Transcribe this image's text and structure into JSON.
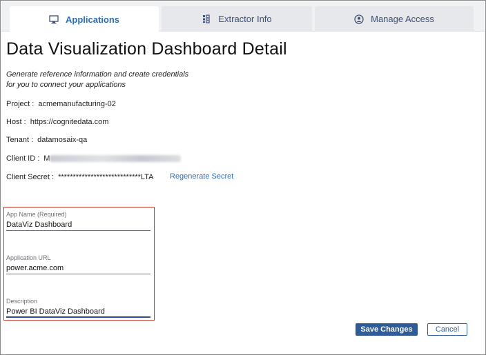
{
  "tabs": [
    {
      "label": "Applications",
      "icon": "monitor-icon",
      "active": true
    },
    {
      "label": "Extractor Info",
      "icon": "extractor-icon",
      "active": false
    },
    {
      "label": "Manage Access",
      "icon": "user-circle-icon",
      "active": false
    }
  ],
  "page": {
    "title": "Data Visualization Dashboard Detail",
    "subtitle_line1": "Generate reference information and create credentials",
    "subtitle_line2": "for you to connect your applications"
  },
  "info": {
    "project_label": "Project :",
    "project_value": "acmemanufacturing-02",
    "host_label": "Host :",
    "host_value": "https://cognitedata.com",
    "tenant_label": "Tenant :",
    "tenant_value": "datamosaix-qa",
    "client_id_label": "Client ID :",
    "client_id_prefix": "M",
    "client_secret_label": "Client Secret :",
    "client_secret_value": "****************************LTA",
    "regenerate_label": "Regenerate Secret"
  },
  "form": {
    "app_name_label": "App Name (Required)",
    "app_name_value": "DataViz Dashboard",
    "app_url_label": "Application URL",
    "app_url_value": "power.acme.com",
    "description_label": "Description",
    "description_value": "Power BI DataViz Dashboard"
  },
  "buttons": {
    "save": "Save Changes",
    "cancel": "Cancel"
  },
  "colors": {
    "accent": "#2e6db4",
    "primary_button": "#2e5c99",
    "highlight_border": "#c0392b"
  }
}
